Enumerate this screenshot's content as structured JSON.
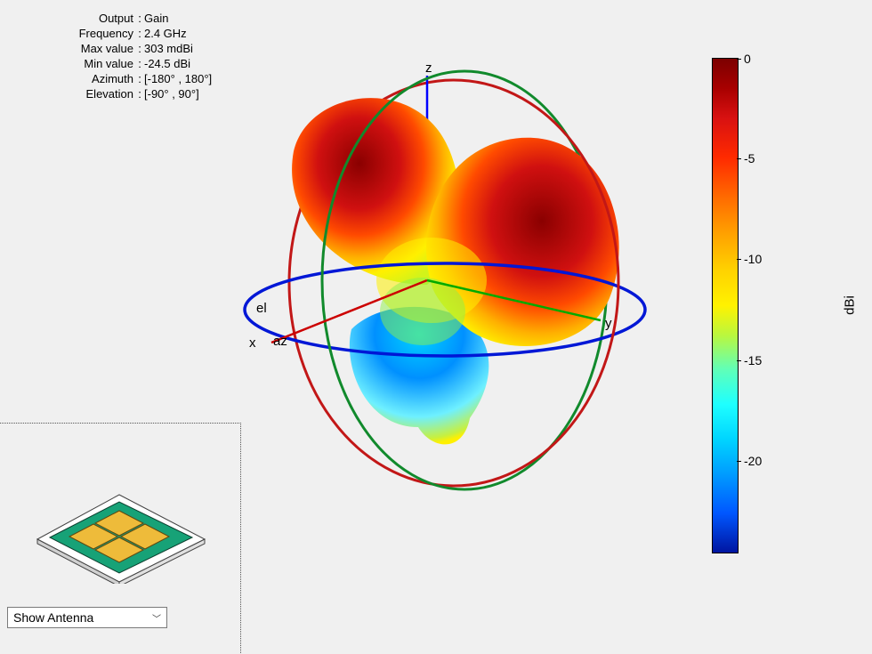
{
  "info": {
    "rows": [
      {
        "label": "Output",
        "value": "Gain"
      },
      {
        "label": "Frequency",
        "value": "2.4 GHz"
      },
      {
        "label": "Max value",
        "value": "303 mdBi"
      },
      {
        "label": "Min value",
        "value": "-24.5 dBi"
      },
      {
        "label": "Azimuth",
        "value": "[-180° , 180°]"
      },
      {
        "label": "Elevation",
        "value": "[-90° , 90°]"
      }
    ],
    "separator": ":"
  },
  "axes3d": {
    "x_label": "x",
    "y_label": "y",
    "z_label": "z",
    "az_label": "az",
    "el_label": "el",
    "colors": {
      "x_axis": "#cc0000",
      "y_axis": "#00aa00",
      "z_axis": "#0000ff",
      "ring_xy": "#0017d6",
      "ring_xz": "#c21717",
      "ring_yz": "#118a2c"
    }
  },
  "colorbar": {
    "unit": "dBi",
    "min": -24.5,
    "max": 0,
    "ticks": [
      {
        "value": "0",
        "frac": 0.0
      },
      {
        "value": "-5",
        "frac": 0.204
      },
      {
        "value": "-10",
        "frac": 0.408
      },
      {
        "value": "-15",
        "frac": 0.612
      },
      {
        "value": "-20",
        "frac": 0.816
      }
    ]
  },
  "dropdown": {
    "label": "Show Antenna"
  },
  "chart_data": {
    "type": "3d-radiation-pattern",
    "quantity": "Gain",
    "unit": "dBi",
    "frequency_ghz": 2.4,
    "value_range_dbi": {
      "min": -24.5,
      "max": 0.303
    },
    "azimuth_range_deg": [
      -180,
      180
    ],
    "elevation_range_deg": [
      -90,
      90
    ],
    "color_scale": {
      "min": -24.5,
      "max": 0,
      "ticks": [
        0,
        -5,
        -10,
        -15,
        -20
      ],
      "unit": "dBi"
    },
    "lobes_qualitative": "Two broad high-gain (red ≈ 0 dBi) lobes toward +z/+y and +z/−y; deep nulls (blue ≤ −20 dBi) near the xy-plane between lobes."
  }
}
